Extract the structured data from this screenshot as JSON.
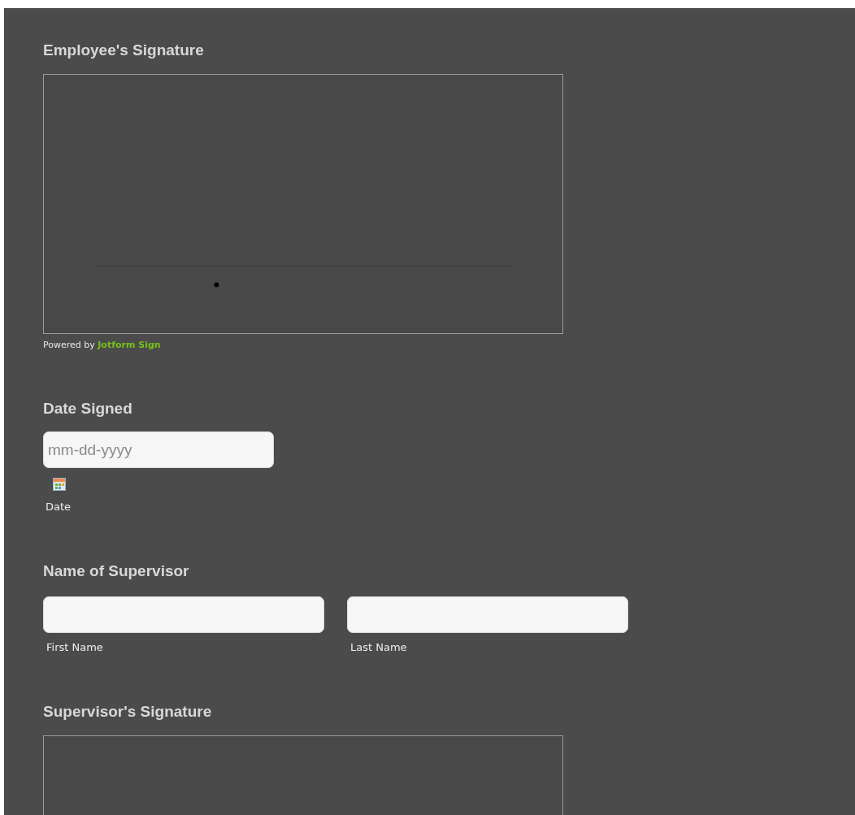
{
  "sections": [
    {
      "kind": "signature",
      "label": "Employee's Signature",
      "powered_by": {
        "prefix": "Powered by",
        "brand": "Jotform Sign"
      }
    },
    {
      "kind": "date",
      "label": "Date Signed",
      "placeholder": "mm-dd-yyyy",
      "sublabel": "Date"
    },
    {
      "kind": "name",
      "label": "Name of Supervisor",
      "fields": [
        {
          "sublabel": "First Name"
        },
        {
          "sublabel": "Last Name"
        }
      ]
    },
    {
      "kind": "signature",
      "label": "Supervisor's Signature"
    }
  ]
}
